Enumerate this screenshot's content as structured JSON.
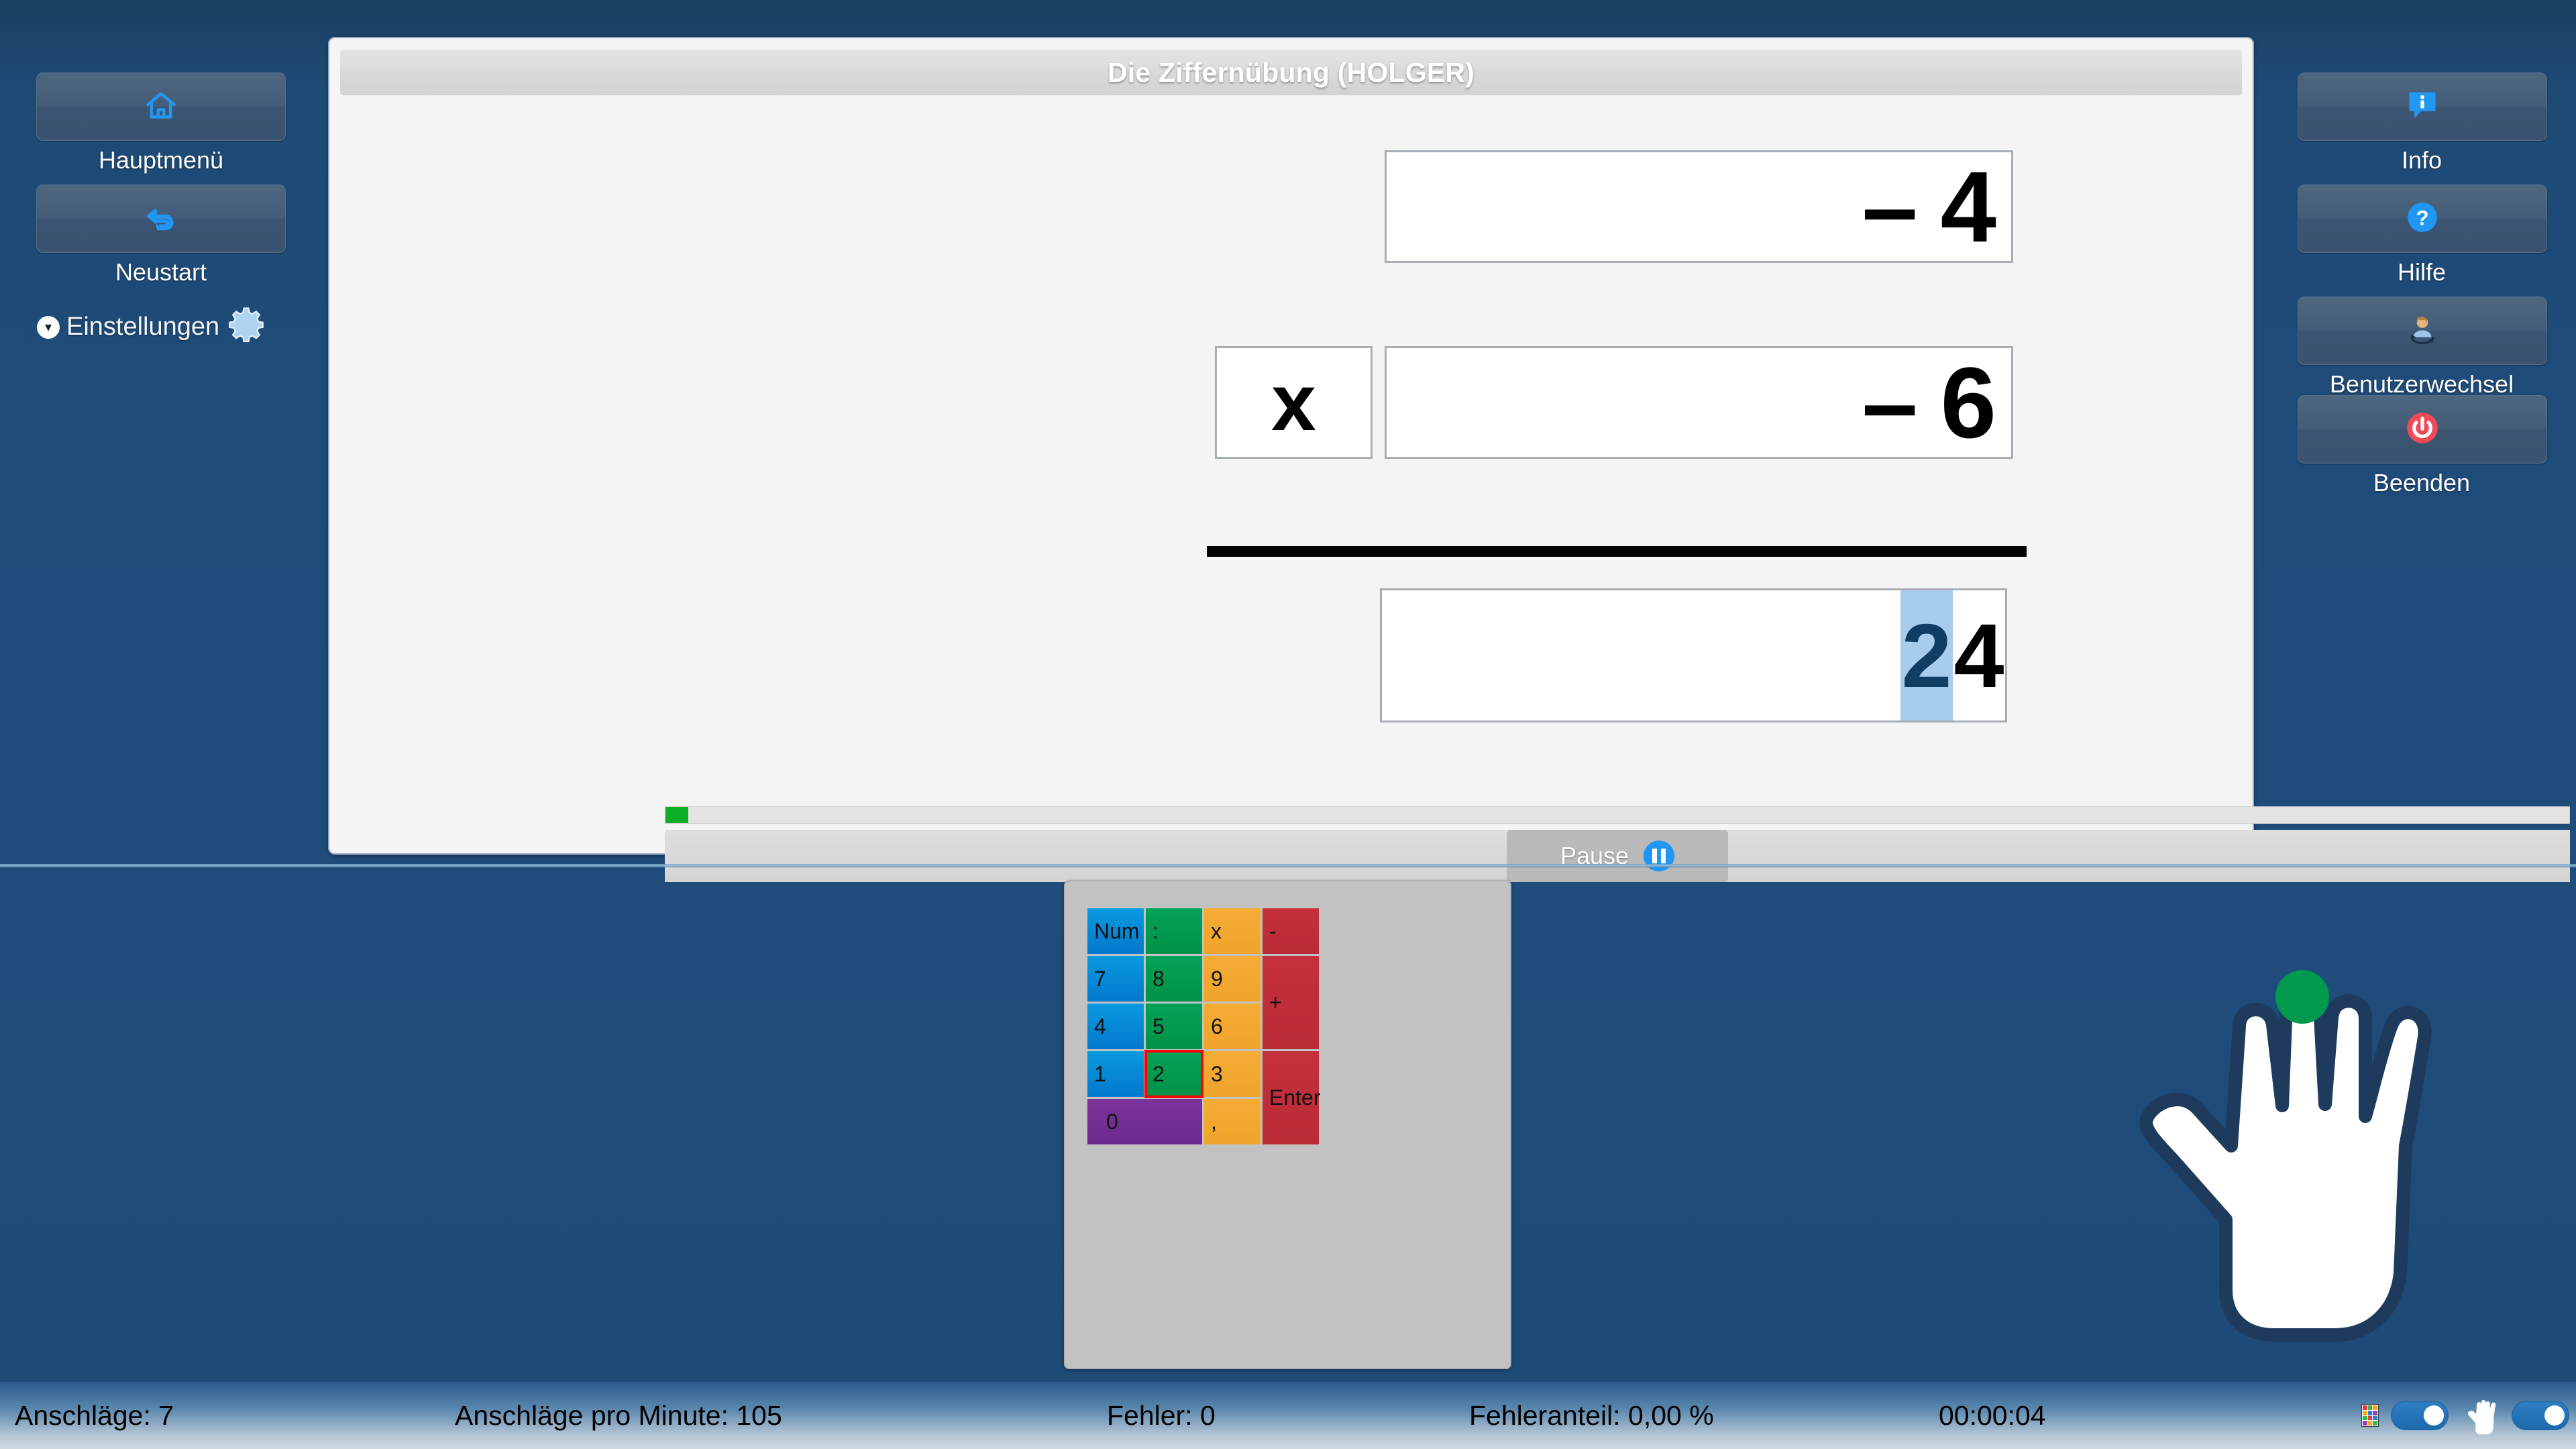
{
  "app": {
    "title": "Die Ziffernübung (HOLGER)",
    "background_color": "#1e4a76",
    "accent_color": "#2196f3"
  },
  "left_sidebar": {
    "buttons": [
      {
        "label": "Hauptmenü",
        "icon": "home-icon"
      },
      {
        "label": "Neustart",
        "icon": "undo-arrow-icon"
      }
    ],
    "settings": {
      "label": "Einstellungen",
      "chevron": "chevron-down-icon",
      "gear": "gear-icon"
    }
  },
  "right_sidebar": {
    "buttons": [
      {
        "label": "Info",
        "icon": "info-speech-bubble-icon"
      },
      {
        "label": "Hilfe",
        "icon": "question-circle-icon"
      },
      {
        "label": "Benutzerwechsel",
        "icon": "switch-user-icon"
      },
      {
        "label": "Beenden",
        "icon": "power-off-icon"
      }
    ]
  },
  "exercise": {
    "operand_top": "– 4",
    "operator": "x",
    "operand_bottom": "– 6",
    "answer_digits": [
      {
        "value": "2",
        "active": true
      },
      {
        "value": "4",
        "active": false
      }
    ],
    "progress_percent": 1.2,
    "progress_color": "#0eae26",
    "pause_label": "Pause",
    "pause_icon": "pause-icon"
  },
  "keypad": {
    "keys": [
      {
        "label": "Num",
        "color": "blue",
        "selected": false,
        "span": "1x1"
      },
      {
        "label": ":",
        "color": "green",
        "selected": false,
        "span": "1x1"
      },
      {
        "label": "x",
        "color": "orange",
        "selected": false,
        "span": "1x1"
      },
      {
        "label": "-",
        "color": "red",
        "selected": false,
        "span": "1x1"
      },
      {
        "label": "7",
        "color": "blue",
        "selected": false,
        "span": "1x1"
      },
      {
        "label": "8",
        "color": "green",
        "selected": false,
        "span": "1x1"
      },
      {
        "label": "9",
        "color": "orange",
        "selected": false,
        "span": "1x1"
      },
      {
        "label": "+",
        "color": "red",
        "selected": false,
        "span": "1x2"
      },
      {
        "label": "4",
        "color": "blue",
        "selected": false,
        "span": "1x1"
      },
      {
        "label": "5",
        "color": "green",
        "selected": false,
        "span": "1x1"
      },
      {
        "label": "6",
        "color": "orange",
        "selected": false,
        "span": "1x1"
      },
      {
        "label": "1",
        "color": "blue",
        "selected": false,
        "span": "1x1"
      },
      {
        "label": "2",
        "color": "green",
        "selected": true,
        "span": "1x1"
      },
      {
        "label": "3",
        "color": "orange",
        "selected": false,
        "span": "1x1"
      },
      {
        "label": "Enter",
        "color": "red",
        "selected": false,
        "span": "1x2"
      },
      {
        "label": "0",
        "color": "purple",
        "selected": false,
        "span": "2x1"
      },
      {
        "label": ",",
        "color": "orange",
        "selected": false,
        "span": "1x1"
      }
    ],
    "colors": {
      "blue": "#0590dd",
      "green": "#00994d",
      "orange": "#f2a72e",
      "red": "#bf2d39",
      "purple": "#74308f",
      "selection_outline": "#ff0000"
    }
  },
  "hand_hint": {
    "icon": "right-hand-icon",
    "highlight_finger": "middle",
    "highlight_color": "#00994d"
  },
  "status_bar": {
    "keystrokes_label": "Anschläge: 7",
    "kpm_label": "Anschläge pro Minute: 105",
    "errors_label": "Fehler: 0",
    "error_rate_label": "Fehleranteil: 0,00 %",
    "time_label": "00:00:04",
    "toggles": [
      {
        "name": "keyboard-display-toggle",
        "on": true
      },
      {
        "name": "hand-display-toggle",
        "on": true
      }
    ],
    "keyboard_icon": "keyboard-mini-icon",
    "hand_icon": "hand-mini-icon"
  }
}
